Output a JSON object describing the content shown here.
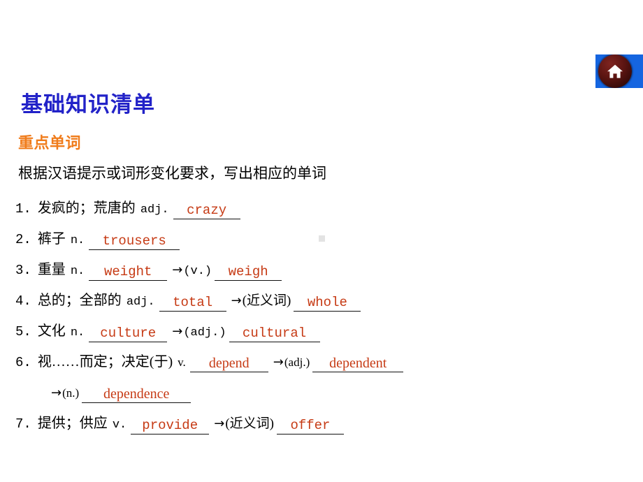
{
  "slide": {
    "title": "基础知识清单",
    "section_title": "重点单词",
    "instruction": "根据汉语提示或词形变化要求，写出相应的单词",
    "accent_blue": "#2222C8",
    "accent_orange": "#F07C1B",
    "answer_red": "#C63A14"
  },
  "home_button": {
    "icon": "home-icon",
    "background": "#1565E0",
    "knob_color": "#5d1512"
  },
  "items": [
    {
      "num": "1.",
      "cn": "发疯的；荒唐的",
      "pos": "adj.",
      "answer": "crazy",
      "extras": []
    },
    {
      "num": "2.",
      "cn": "裤子",
      "pos": "n.",
      "answer": "trousers",
      "extras": []
    },
    {
      "num": "3.",
      "cn": "重量",
      "pos": "n.",
      "answer": "weight",
      "extras": [
        {
          "arrow": "→",
          "hint": "(v.)",
          "answer": "weigh"
        }
      ]
    },
    {
      "num": "4.",
      "cn": "总的；全部的",
      "pos": "adj.",
      "answer": "total",
      "extras": [
        {
          "arrow": "→",
          "hint": "(近义词)",
          "hint_cjk": true,
          "answer": "whole"
        }
      ]
    },
    {
      "num": "5.",
      "cn": "文化",
      "pos": "n.",
      "answer": "culture",
      "extras": [
        {
          "arrow": "→",
          "hint": "(adj.)",
          "answer": "cultural"
        }
      ]
    },
    {
      "num": "6.",
      "cn": "视……而定；决定(于)",
      "pos": "v.",
      "answer": "depend",
      "extras": [
        {
          "arrow": "→",
          "hint": "(adj.)",
          "answer": "dependent"
        }
      ],
      "continuation": {
        "arrow": "→",
        "hint": "(n.)",
        "answer": "dependence"
      }
    },
    {
      "num": "7.",
      "cn": "提供；供应",
      "pos": "v.",
      "answer": "provide",
      "extras": [
        {
          "arrow": "→",
          "hint": "(近义词)",
          "hint_cjk": true,
          "answer": "offer"
        }
      ]
    }
  ]
}
